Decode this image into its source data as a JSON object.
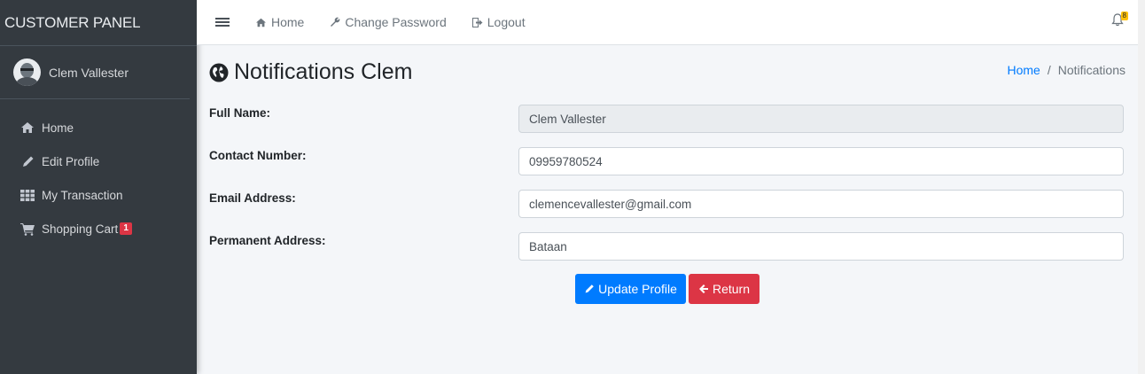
{
  "brand": "CUSTOMER PANEL",
  "user": {
    "name": "Clem Vallester"
  },
  "sidebar": {
    "items": [
      {
        "label": "Home",
        "icon": "home-icon"
      },
      {
        "label": "Edit Profile",
        "icon": "pencil-icon"
      },
      {
        "label": "My Transaction",
        "icon": "grid-icon"
      },
      {
        "label": "Shopping Cart",
        "icon": "cart-icon",
        "badge": "1"
      }
    ]
  },
  "topbar": {
    "home": "Home",
    "change_password": "Change Password",
    "logout": "Logout",
    "notification_count": "8"
  },
  "page": {
    "title": "Notifications Clem",
    "breadcrumb": {
      "home": "Home",
      "sep": "/",
      "current": "Notifications"
    }
  },
  "form": {
    "full_name_label": "Full Name:",
    "full_name": "Clem Vallester",
    "contact_label": "Contact Number:",
    "contact": "09959780524",
    "email_label": "Email Address:",
    "email": "clemencevallester@gmail.com",
    "address_label": "Permanent Address:",
    "address": "Bataan"
  },
  "buttons": {
    "update": "Update Profile",
    "return": "Return"
  },
  "colors": {
    "sidebar": "#343a40",
    "primary": "#007bff",
    "danger": "#dc3545",
    "warning": "#ffc107",
    "content_bg": "#f4f6f9"
  }
}
